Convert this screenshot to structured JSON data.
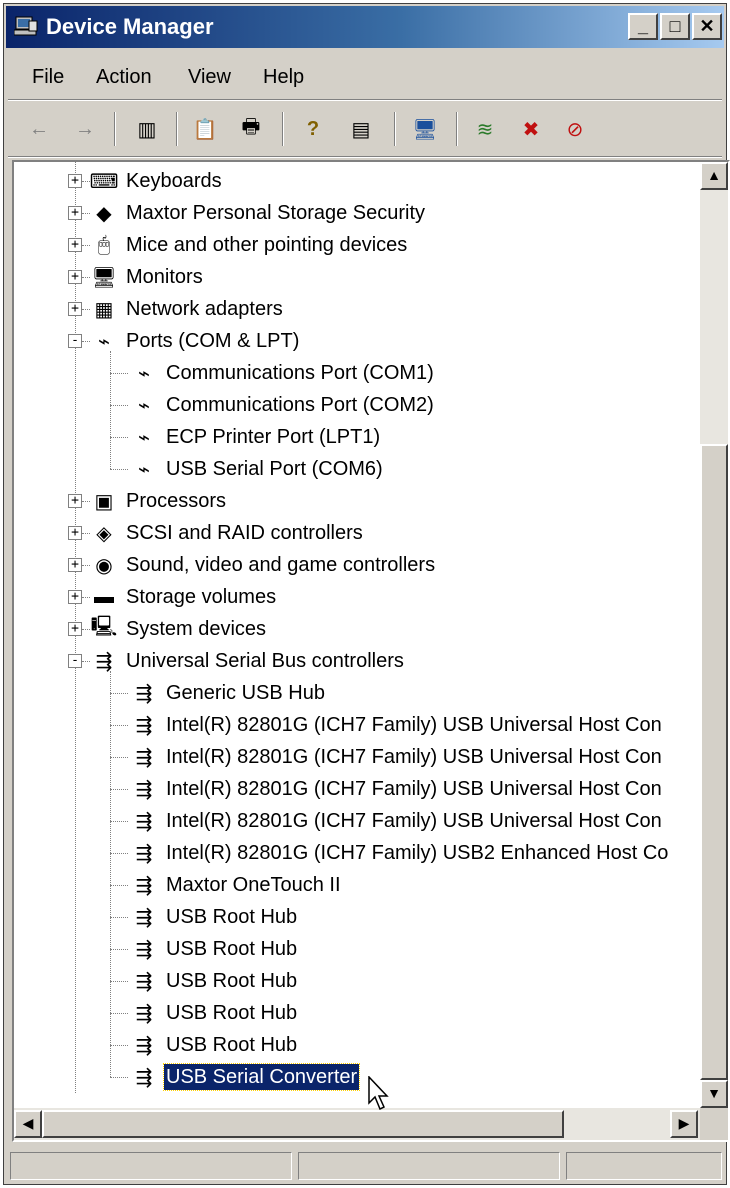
{
  "window": {
    "title": "Device Manager",
    "controls": {
      "minimize": "_",
      "maximize": "□",
      "close": "✕"
    }
  },
  "menu": [
    "File",
    "Action",
    "View",
    "Help"
  ],
  "toolbar": {
    "buttons": [
      {
        "name": "back-icon",
        "glyph": "←"
      },
      {
        "name": "forward-icon",
        "glyph": "→"
      },
      {
        "name": "show-hide-console-tree-icon",
        "glyph": "▥"
      },
      {
        "name": "properties-icon",
        "glyph": "📋"
      },
      {
        "name": "print-icon",
        "glyph": "🖶"
      },
      {
        "name": "help-icon",
        "glyph": "?"
      },
      {
        "name": "show-hide-action-pane-icon",
        "glyph": "▤"
      },
      {
        "name": "scan-hardware-icon",
        "glyph": "🖥"
      },
      {
        "name": "update-driver-icon",
        "glyph": "≋"
      },
      {
        "name": "uninstall-icon",
        "glyph": "✖"
      },
      {
        "name": "disable-icon",
        "glyph": "⊘"
      }
    ]
  },
  "tree": {
    "items": [
      {
        "label": "Keyboards",
        "level": 0,
        "expander": "+",
        "icon": "keyboard-icon",
        "glyph": "⌨"
      },
      {
        "label": "Maxtor Personal Storage Security",
        "level": 0,
        "expander": "+",
        "icon": "diamond-icon",
        "glyph": "◆"
      },
      {
        "label": "Mice and other pointing devices",
        "level": 0,
        "expander": "+",
        "icon": "mouse-icon",
        "glyph": "🖱"
      },
      {
        "label": "Monitors",
        "level": 0,
        "expander": "+",
        "icon": "monitor-icon",
        "glyph": "🖥"
      },
      {
        "label": "Network adapters",
        "level": 0,
        "expander": "+",
        "icon": "network-adapter-icon",
        "glyph": "▦"
      },
      {
        "label": "Ports (COM & LPT)",
        "level": 0,
        "expander": "-",
        "icon": "port-icon",
        "glyph": "⌁"
      },
      {
        "label": "Communications Port (COM1)",
        "level": 1,
        "icon": "port-icon",
        "glyph": "⌁"
      },
      {
        "label": "Communications Port (COM2)",
        "level": 1,
        "icon": "port-icon",
        "glyph": "⌁"
      },
      {
        "label": "ECP Printer Port (LPT1)",
        "level": 1,
        "icon": "port-icon",
        "glyph": "⌁"
      },
      {
        "label": "USB Serial Port (COM6)",
        "level": 1,
        "icon": "port-icon",
        "glyph": "⌁"
      },
      {
        "label": "Processors",
        "level": 0,
        "expander": "+",
        "icon": "processor-icon",
        "glyph": "▣"
      },
      {
        "label": "SCSI and RAID controllers",
        "level": 0,
        "expander": "+",
        "icon": "scsi-icon",
        "glyph": "◈"
      },
      {
        "label": "Sound, video and game controllers",
        "level": 0,
        "expander": "+",
        "icon": "sound-icon",
        "glyph": "◉"
      },
      {
        "label": "Storage volumes",
        "level": 0,
        "expander": "+",
        "icon": "storage-volume-icon",
        "glyph": "▬"
      },
      {
        "label": "System devices",
        "level": 0,
        "expander": "+",
        "icon": "system-device-icon",
        "glyph": "🖳"
      },
      {
        "label": "Universal Serial Bus controllers",
        "level": 0,
        "expander": "-",
        "icon": "usb-icon",
        "glyph": "⇶"
      },
      {
        "label": "Generic USB Hub",
        "level": 1,
        "icon": "usb-icon",
        "glyph": "⇶"
      },
      {
        "label": "Intel(R) 82801G (ICH7 Family) USB Universal Host Con",
        "level": 1,
        "icon": "usb-icon",
        "glyph": "⇶"
      },
      {
        "label": "Intel(R) 82801G (ICH7 Family) USB Universal Host Con",
        "level": 1,
        "icon": "usb-icon",
        "glyph": "⇶"
      },
      {
        "label": "Intel(R) 82801G (ICH7 Family) USB Universal Host Con",
        "level": 1,
        "icon": "usb-icon",
        "glyph": "⇶"
      },
      {
        "label": "Intel(R) 82801G (ICH7 Family) USB Universal Host Con",
        "level": 1,
        "icon": "usb-icon",
        "glyph": "⇶"
      },
      {
        "label": "Intel(R) 82801G (ICH7 Family) USB2 Enhanced Host Co",
        "level": 1,
        "icon": "usb-icon",
        "glyph": "⇶"
      },
      {
        "label": "Maxtor OneTouch II",
        "level": 1,
        "icon": "usb-icon",
        "glyph": "⇶"
      },
      {
        "label": "USB Root Hub",
        "level": 1,
        "icon": "usb-icon",
        "glyph": "⇶"
      },
      {
        "label": "USB Root Hub",
        "level": 1,
        "icon": "usb-icon",
        "glyph": "⇶"
      },
      {
        "label": "USB Root Hub",
        "level": 1,
        "icon": "usb-icon",
        "glyph": "⇶"
      },
      {
        "label": "USB Root Hub",
        "level": 1,
        "icon": "usb-icon",
        "glyph": "⇶"
      },
      {
        "label": "USB Root Hub",
        "level": 1,
        "icon": "usb-icon",
        "glyph": "⇶"
      },
      {
        "label": "USB Serial Converter",
        "level": 1,
        "icon": "usb-icon",
        "glyph": "⇶",
        "selected": true
      }
    ]
  },
  "scrollbars": {
    "up": "▲",
    "down": "▼",
    "left": "◀",
    "right": "▶"
  },
  "statusbar": {
    "panels": [
      "",
      "",
      ""
    ]
  },
  "colors": {
    "titlebar_start": "#0a246a",
    "titlebar_end": "#a6caf0",
    "selection": "#0a246a",
    "face": "#d4d0c8"
  }
}
